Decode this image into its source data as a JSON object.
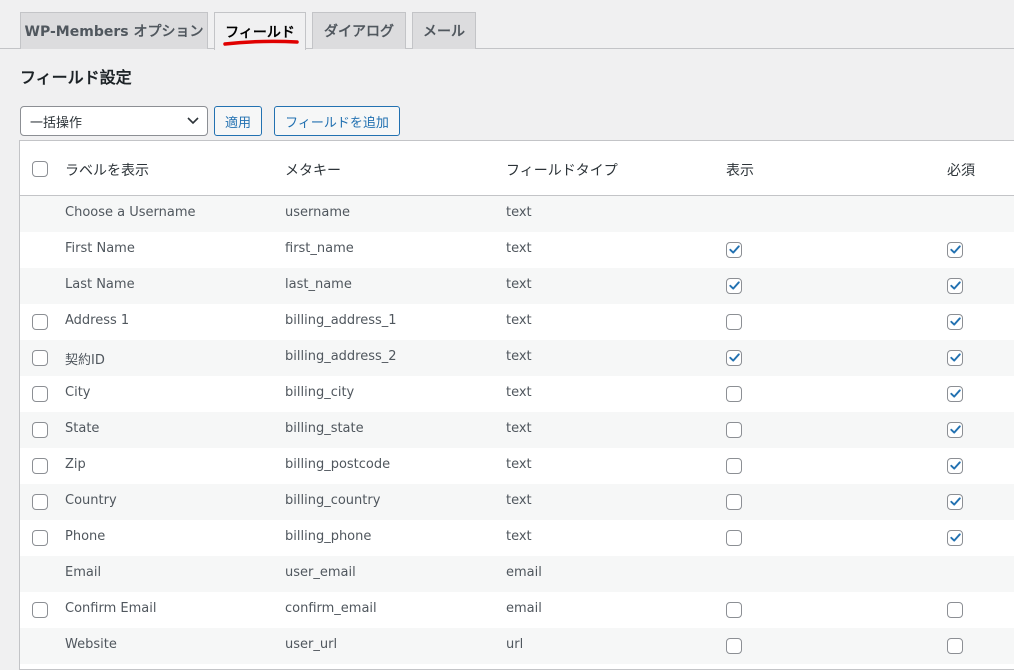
{
  "tabs": [
    {
      "label": "WP-Members オプション",
      "active": false
    },
    {
      "label": "フィールド",
      "active": true
    },
    {
      "label": "ダイアログ",
      "active": false
    },
    {
      "label": "メール",
      "active": false
    }
  ],
  "page_title": "フィールド設定",
  "bulk_action": {
    "selected": "一括操作"
  },
  "buttons": {
    "apply": "適用",
    "add_field": "フィールドを追加"
  },
  "table": {
    "headers": {
      "label": "ラベルを表示",
      "meta": "メタキー",
      "type": "フィールドタイプ",
      "display": "表示",
      "required": "必須"
    },
    "rows": [
      {
        "label": "Choose a Username",
        "meta": "username",
        "type": "text",
        "select": null,
        "display": null,
        "required": null
      },
      {
        "label": "First Name",
        "meta": "first_name",
        "type": "text",
        "select": null,
        "display": true,
        "required": true
      },
      {
        "label": "Last Name",
        "meta": "last_name",
        "type": "text",
        "select": null,
        "display": true,
        "required": true
      },
      {
        "label": "Address 1",
        "meta": "billing_address_1",
        "type": "text",
        "select": false,
        "display": false,
        "required": true
      },
      {
        "label": "契約ID",
        "meta": "billing_address_2",
        "type": "text",
        "select": false,
        "display": true,
        "required": true
      },
      {
        "label": "City",
        "meta": "billing_city",
        "type": "text",
        "select": false,
        "display": false,
        "required": true
      },
      {
        "label": "State",
        "meta": "billing_state",
        "type": "text",
        "select": false,
        "display": false,
        "required": true
      },
      {
        "label": "Zip",
        "meta": "billing_postcode",
        "type": "text",
        "select": false,
        "display": false,
        "required": true
      },
      {
        "label": "Country",
        "meta": "billing_country",
        "type": "text",
        "select": false,
        "display": false,
        "required": true
      },
      {
        "label": "Phone",
        "meta": "billing_phone",
        "type": "text",
        "select": false,
        "display": false,
        "required": true
      },
      {
        "label": "Email",
        "meta": "user_email",
        "type": "email",
        "select": null,
        "display": null,
        "required": null
      },
      {
        "label": "Confirm Email",
        "meta": "confirm_email",
        "type": "email",
        "select": false,
        "display": false,
        "required": false
      },
      {
        "label": "Website",
        "meta": "user_url",
        "type": "url",
        "select": null,
        "display": false,
        "required": false
      }
    ]
  }
}
